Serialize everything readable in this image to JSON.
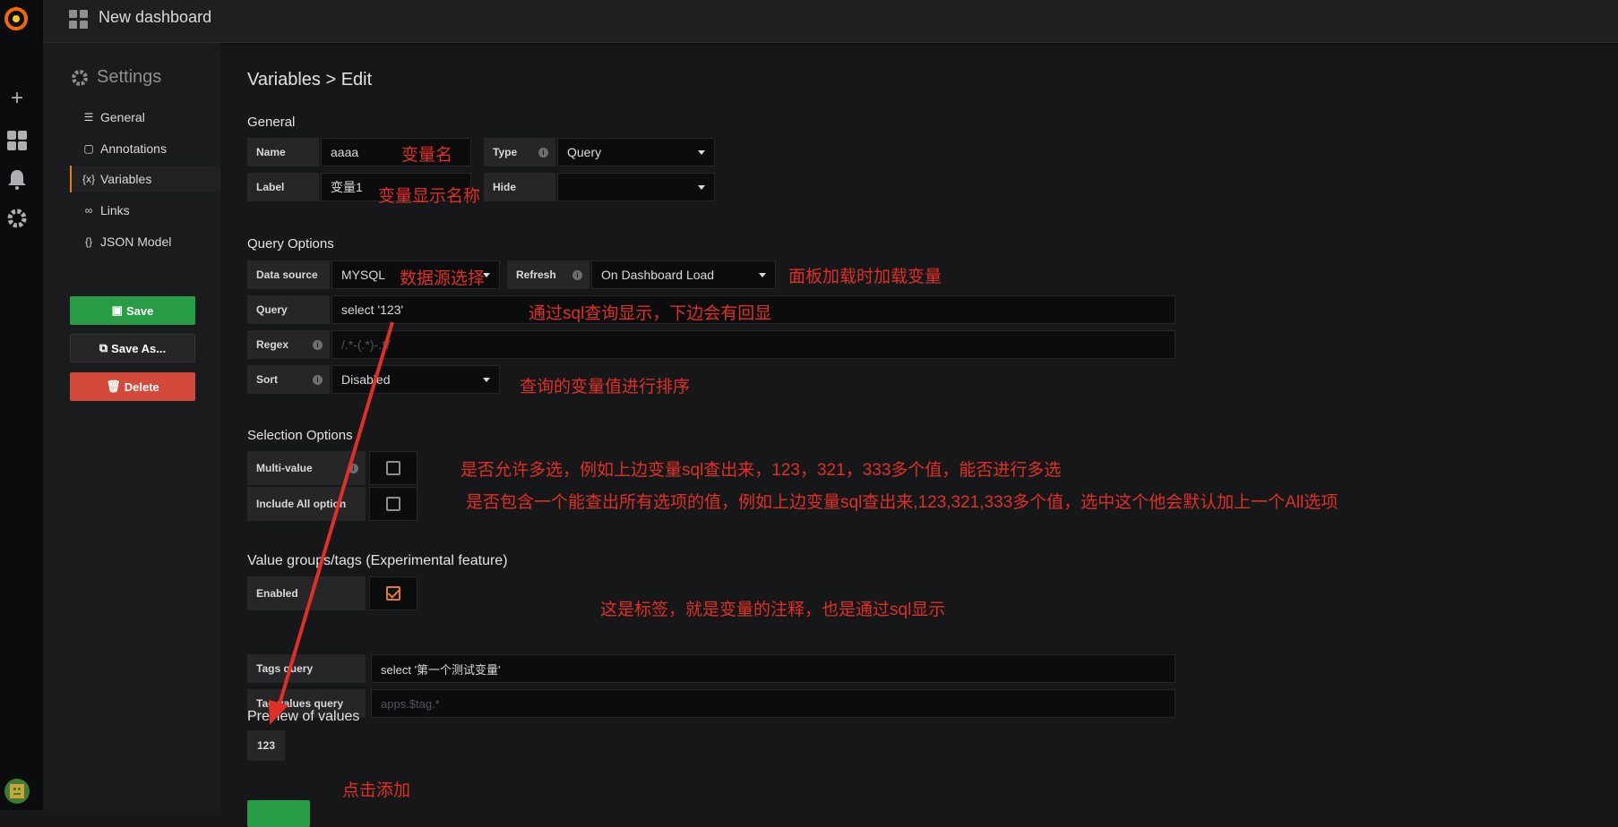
{
  "navbar": {
    "title": "New dashboard"
  },
  "settings_nav": {
    "title": "Settings",
    "items": [
      {
        "label": "General",
        "icon": "sliders-icon"
      },
      {
        "label": "Annotations",
        "icon": "comment-icon"
      },
      {
        "label": "Variables",
        "icon": "variable-icon",
        "active": true
      },
      {
        "label": "Links",
        "icon": "link-icon"
      },
      {
        "label": "JSON Model",
        "icon": "json-icon"
      }
    ],
    "save_label": "Save",
    "save_as_label": "Save As...",
    "delete_label": "Delete"
  },
  "page": {
    "title": "Variables > Edit"
  },
  "general": {
    "heading": "General",
    "name_label": "Name",
    "name_value": "aaaa",
    "type_label": "Type",
    "type_value": "Query",
    "label_label": "Label",
    "label_value": "变量1",
    "hide_label": "Hide",
    "hide_value": ""
  },
  "query_options": {
    "heading": "Query Options",
    "datasource_label": "Data source",
    "datasource_value": "MYSQL",
    "refresh_label": "Refresh",
    "refresh_value": "On Dashboard Load",
    "query_label": "Query",
    "query_value": "select '123'",
    "regex_label": "Regex",
    "regex_placeholder": "/.*-(.*)-.*/",
    "sort_label": "Sort",
    "sort_value": "Disabled"
  },
  "selection_options": {
    "heading": "Selection Options",
    "multi_label": "Multi-value",
    "include_all_label": "Include All option"
  },
  "value_groups": {
    "heading": "Value groups/tags (Experimental feature)",
    "enabled_label": "Enabled",
    "tags_query_label": "Tags query",
    "tags_query_value": "select '第一个测试变量'",
    "tag_values_label": "Tag values query",
    "tag_values_placeholder": "apps.$tag.*"
  },
  "preview": {
    "heading": "Preview of values",
    "values": [
      "123"
    ]
  },
  "annotations": {
    "var_name": "变量名",
    "var_display": "变量显示名称",
    "datasource": "数据源选择",
    "refresh": "面板加载时加载变量",
    "query": "通过sql查询显示，下边会有回显",
    "sort": "查询的变量值进行排序",
    "multi": "是否允许多选，例如上边变量sql查出来，123，321，333多个值，能否进行多选",
    "include_all": "是否包含一个能查出所有选项的值，例如上边变量sql查出来,123,321,333多个值，选中这个他会默认加上一个All选项",
    "tags": "这是标签，就是变量的注释，也是通过sql显示",
    "click_add": "点击添加"
  },
  "colors": {
    "accent": "#eb7b18",
    "save": "#299c46",
    "delete": "#d44a3a",
    "annotation": "#e02f25"
  }
}
